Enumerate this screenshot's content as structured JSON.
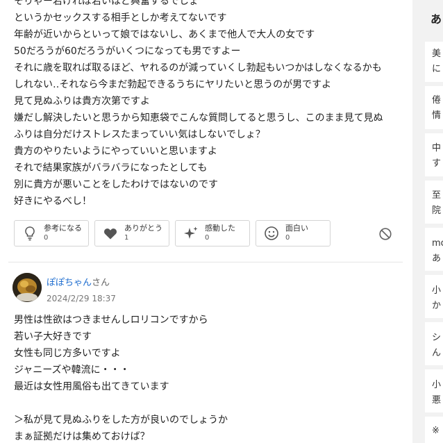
{
  "answer1": {
    "lines": [
      "そりゃー若ければ若いほど興奮するでしょ",
      "というかセックスする相手としか考えてないです",
      "年齢が近いからといって娘ではないし、あくまで他人で大人の女です",
      "50だろうが60だろうがいくつになっても男ですよー",
      "それに歳を取れば取るほど、ヤれるのが減っていくし勃起もいつかはしなくなるかも",
      "しれない‥それなら今まだ勃起できるうちにヤリたいと思うのが男ですよ",
      "見て見ぬふりは貴方次第ですよ",
      "嫌だし解決したいと思うから知恵袋でこんな質問してると思うし、このまま見て見ぬ",
      "ふりは自分だけストレスたまっていい気はしないでしょ？",
      "貴方のやりたいようにやっていいと思いますよ",
      "それで結果家族がバラバラになったとしても",
      "別に貴方が悪いことをしたわけではないのです",
      "好きにやるべし！"
    ]
  },
  "reactions": [
    {
      "label": "参考になる",
      "count": "0",
      "icon": "lightbulb-icon"
    },
    {
      "label": "ありがとう",
      "count": "1",
      "icon": "heart-icon"
    },
    {
      "label": "感動した",
      "count": "0",
      "icon": "sparkle-icon"
    },
    {
      "label": "面白い",
      "count": "0",
      "icon": "smile-icon"
    }
  ],
  "answer2": {
    "user_name": "ぽぽちゃん",
    "user_suffix": "さん",
    "date": "2024/2/29 18:37",
    "lines": [
      "男性は性欲はつきませんしロリコンですから",
      "若い子大好きです",
      "女性も同じ方多いですよ",
      "ジャニーズや韓流に・・・",
      "最近は女性用風俗も出てきています",
      "",
      "＞私が見て見ぬふりをした方が良いのでしょうか",
      "まぁ証拠だけは集めておけば？"
    ]
  },
  "sidebar": {
    "heading": "あ",
    "items": [
      [
        "美",
        "に"
      ],
      [
        "倦",
        "情"
      ],
      [
        "中",
        "す"
      ],
      [
        "至",
        "院"
      ],
      [
        "mo",
        "あ"
      ],
      [
        "小",
        "か"
      ],
      [
        "シ",
        "ん"
      ],
      [
        "小",
        "悪"
      ],
      [
        "※"
      ]
    ]
  },
  "colors": {
    "link": "#1d6ccf",
    "sidebar_bg": "#f2f2f2",
    "border": "#d4d4d4"
  }
}
